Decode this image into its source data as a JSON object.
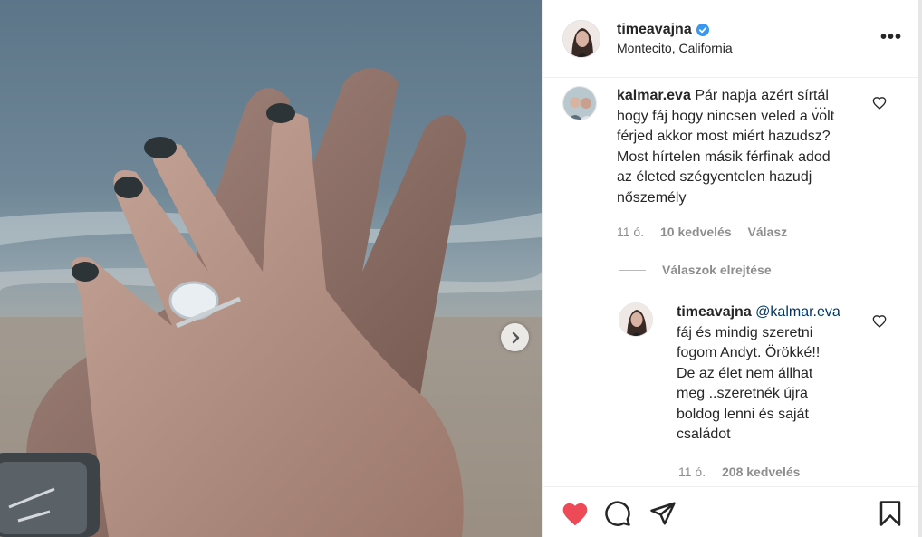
{
  "header": {
    "username": "timeavajna",
    "location": "Montecito, California",
    "verified_icon": "verified-badge-icon",
    "more_icon": "more-options-icon"
  },
  "comments": [
    {
      "username": "kalmar.eva",
      "lines": [
        "Pár napja azért sírtál",
        "hogy fáj hogy nincsen veled a volt",
        "férjed akkor most miért hazudsz?",
        "Most hírtelen másik férfinak adod",
        "az életed szégyentelen hazudj",
        "nőszemély"
      ],
      "overlay_dots": "...",
      "time": "11 ó.",
      "likes": "10 kedvelés",
      "reply": "Válasz"
    }
  ],
  "hide_replies": "Válaszok elrejtése",
  "reply": {
    "username": "timeavajna",
    "mention": "@kalmar.eva",
    "lines": [
      "fáj és mindig szeretni",
      "fogom Andyt. Örökké!!",
      "De az élet nem állhat",
      "meg ..szeretnék újra",
      "boldog lenni és saját",
      "családot"
    ],
    "time": "11 ó.",
    "likes": "208 kedvelés"
  },
  "actions": {
    "like_icon": "heart-filled-icon",
    "comment_icon": "comment-bubble-icon",
    "share_icon": "share-plane-icon",
    "save_icon": "bookmark-icon"
  },
  "colors": {
    "like_red": "#ed4956",
    "verified_blue": "#3897f0",
    "text": "#262626",
    "muted": "#8e8e8e"
  }
}
